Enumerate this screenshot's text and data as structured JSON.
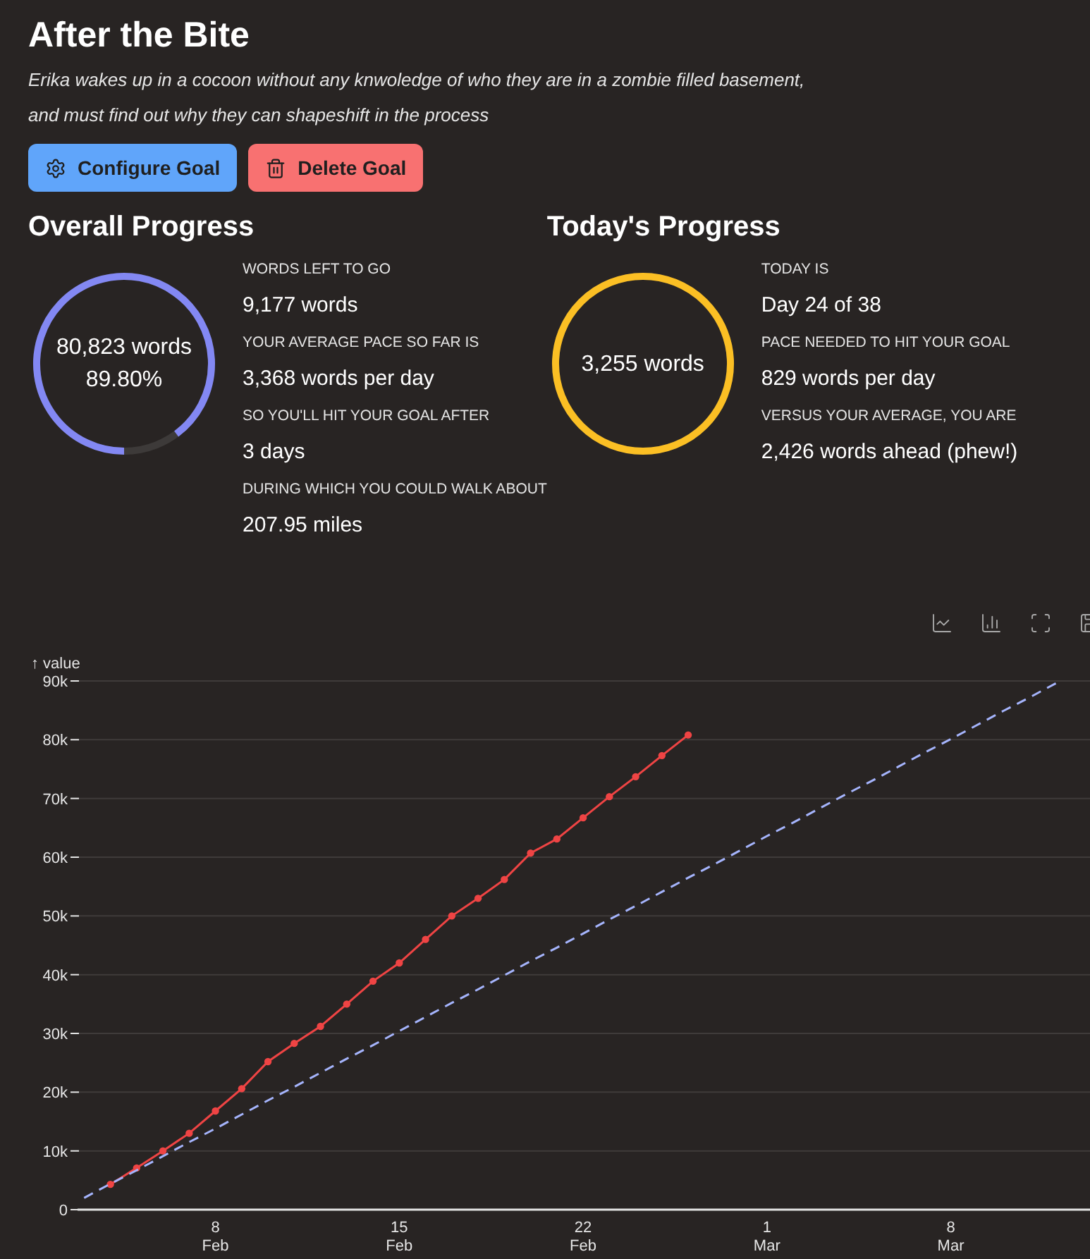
{
  "title": "After the Bite",
  "description": "Erika wakes up in a cocoon without any knwoledge of who they are in a zombie filled basement, and must find out why they can shapeshift in the process",
  "buttons": [
    {
      "kind": "configure",
      "label": "Configure Goal"
    },
    {
      "kind": "delete",
      "label": "Delete Goal"
    }
  ],
  "panels": [
    {
      "heading": "Overall Progress",
      "ring": {
        "color": "#8388f3",
        "level": 0.898,
        "lines": [
          "80,823 words",
          "89.80%"
        ]
      },
      "stats": [
        {
          "label": "WORDS LEFT TO GO",
          "value": "9,177 words"
        },
        {
          "label": "YOUR AVERAGE PACE SO FAR IS",
          "value": "3,368 words per day"
        },
        {
          "label": "SO YOU'LL HIT YOUR GOAL AFTER",
          "value": "3 days"
        },
        {
          "label": "DURING WHICH YOU COULD WALK ABOUT",
          "value": "207.95 miles"
        }
      ]
    },
    {
      "heading": "Today's Progress",
      "ring": {
        "color": "#fbbf24",
        "level": 1,
        "lines": [
          "3,255 words"
        ]
      },
      "stats": [
        {
          "label": "TODAY IS",
          "value": "Day 24 of 38"
        },
        {
          "label": "PACE NEEDED TO HIT YOUR GOAL",
          "value": "829 words per day"
        },
        {
          "label": "VERSUS YOUR AVERAGE, YOU ARE",
          "value": "2,426 words ahead (phew!)"
        }
      ]
    }
  ],
  "chart_toolbar": [
    {
      "kind": "line"
    },
    {
      "kind": "bar"
    },
    {
      "kind": "fullscreen"
    },
    {
      "kind": "save"
    }
  ],
  "chart": {
    "chart_data": {
      "type": "line",
      "ylabel": "↑ value",
      "categories": [
        null,
        null,
        null,
        null,
        null,
        "8 Feb",
        null,
        null,
        null,
        null,
        null,
        null,
        "15 Feb",
        null,
        null,
        null,
        null,
        null,
        null,
        "22 Feb",
        null,
        null,
        null,
        null,
        null,
        null,
        "1 Mar",
        null,
        null,
        null,
        null,
        null,
        null,
        "8 Mar",
        null,
        null,
        null,
        null
      ],
      "ylim": [
        0,
        90000
      ],
      "grid": true,
      "yticks": [
        {
          "value": 0,
          "label": "0"
        },
        {
          "value": 10000,
          "label": "10k"
        },
        {
          "value": 20000,
          "label": "20k"
        },
        {
          "value": 30000,
          "label": "30k"
        },
        {
          "value": 40000,
          "label": "40k"
        },
        {
          "value": 50000,
          "label": "50k"
        },
        {
          "value": 60000,
          "label": "60k"
        },
        {
          "value": 70000,
          "label": "70k"
        },
        {
          "value": 80000,
          "label": "80k"
        },
        {
          "value": 90000,
          "label": "90k"
        }
      ],
      "series": [
        {
          "color": "#ef4444",
          "line_style": "solid",
          "marker": "circle",
          "values": [
            null,
            4300,
            7100,
            10000,
            13000,
            16800,
            20600,
            25200,
            28300,
            31200,
            35000,
            38900,
            42000,
            46000,
            50000,
            53000,
            56200,
            60700,
            63100,
            66700,
            70300,
            73700,
            77300,
            80800,
            null,
            null,
            null,
            null,
            null,
            null,
            null,
            null,
            null,
            null,
            null,
            null,
            null,
            null
          ]
        },
        {
          "color": "#a5b4fc",
          "line_style": "dashed",
          "values": [
            2000,
            4400,
            6700,
            9100,
            11500,
            13800,
            16200,
            18600,
            20900,
            23300,
            25700,
            28000,
            30400,
            32800,
            35200,
            37500,
            39900,
            42300,
            44600,
            47000,
            49400,
            51700,
            54100,
            56500,
            58800,
            61200,
            63600,
            65900,
            68300,
            70700,
            73000,
            75400,
            77800,
            80100,
            82500,
            84900,
            87200,
            89600
          ]
        }
      ]
    }
  }
}
